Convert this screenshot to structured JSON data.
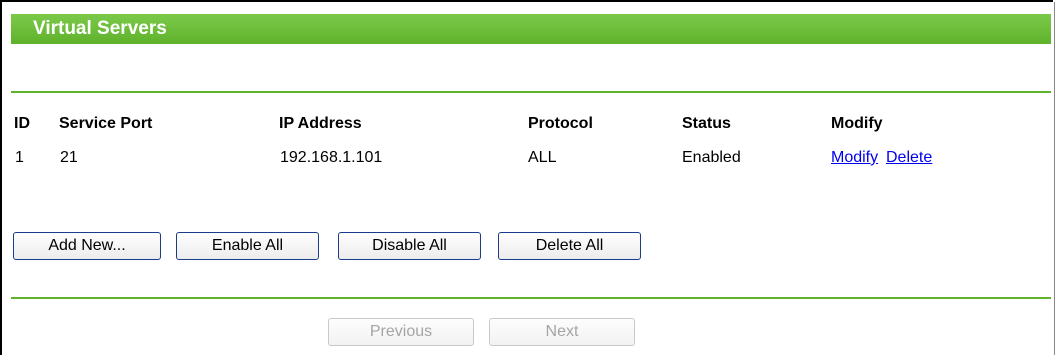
{
  "title": "Virtual Servers",
  "table": {
    "headers": [
      "ID",
      "Service Port",
      "IP Address",
      "Protocol",
      "Status",
      "Modify"
    ],
    "rows": [
      {
        "id": "1",
        "service_port": "21",
        "ip_address": "192.168.1.101",
        "protocol": "ALL",
        "status": "Enabled",
        "modify_label": "Modify",
        "delete_label": "Delete"
      }
    ]
  },
  "actions": {
    "add_new": "Add New...",
    "enable_all": "Enable All",
    "disable_all": "Disable All",
    "delete_all": "Delete All"
  },
  "pagination": {
    "previous": "Previous",
    "next": "Next"
  },
  "colors": {
    "title_bar": "#6cbf3a",
    "divider": "#5fb22c",
    "link": "#0000ee"
  }
}
